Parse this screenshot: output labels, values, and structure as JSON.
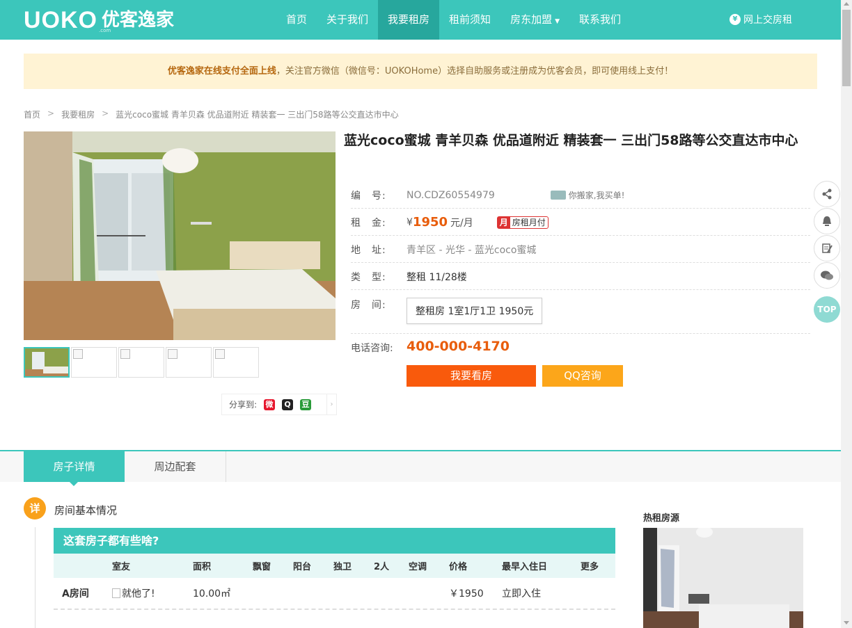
{
  "header": {
    "logo_mark": "UOKO",
    "logo_cn": "优客逸家",
    "logo_sub": ".com",
    "nav": [
      {
        "label": "首页"
      },
      {
        "label": "关于我们"
      },
      {
        "label": "我要租房"
      },
      {
        "label": "租前须知"
      },
      {
        "label": "房东加盟"
      },
      {
        "label": "联系我们"
      }
    ],
    "nav_active_index": 2,
    "pay_label": "网上交房租",
    "brand_color": "#3cc6bb"
  },
  "notice": {
    "bold": "优客逸家在线支付全面上线",
    "text": "，关注官方微信（微信号：UOKOHome）选择自助服务或注册成为优客会员，即可使用线上支付！"
  },
  "breadcrumb": [
    "首页",
    "我要租房",
    "蓝光coco蜜城 青羊贝森 优品道附近 精装套一 三出门58路等公交直达市中心"
  ],
  "listing": {
    "title": "蓝光coco蜜城 青羊贝森 优品道附近 精装套一 三出门58路等公交直达市中心",
    "id_label": "编　号:",
    "id_value": "NO.CDZ60554979",
    "move_tag": "你搬家,我买单!",
    "rent_label": "租　金:",
    "rent_currency": "¥",
    "rent_amount": "1950",
    "rent_unit": "元/月",
    "monthly_badge_icon": "月",
    "monthly_badge_text": "房租月付",
    "address_label": "地　址:",
    "address_value": "青羊区 - 光华 - 蓝光coco蜜城",
    "type_label": "类　型:",
    "type_value": "整租 11/28楼",
    "room_label": "房　间:",
    "room_value": "整租房 1室1厅1卫 1950元",
    "phone_label": "电话咨询:",
    "phone_value": "400-000-4170",
    "btn_view": "我要看房",
    "btn_qq": "QQ咨询",
    "share_label": "分享到:",
    "share_icons": [
      "weibo-icon",
      "qq-icon",
      "douban-icon"
    ]
  },
  "float_bar": {
    "items": [
      "share-icon",
      "qq-bell-icon",
      "edit-icon",
      "wechat-icon"
    ],
    "top_label": "TOP"
  },
  "tabs": [
    {
      "label": "房子详情"
    },
    {
      "label": "周边配套"
    }
  ],
  "section": {
    "icon_text": "详",
    "title": "房间基本情况"
  },
  "room_table": {
    "title": "这套房子都有些啥?",
    "headers": [
      "室友",
      "面积",
      "飘窗",
      "阳台",
      "独卫",
      "2人",
      "空调",
      "价格",
      "最早入住日",
      "更多"
    ],
    "rows": [
      {
        "name": "A房间",
        "roommate_alt": "就他了!",
        "area": "10.00㎡",
        "price": "￥1950",
        "move_in": "立即入住"
      }
    ]
  },
  "hot": {
    "title": "热租房源"
  }
}
